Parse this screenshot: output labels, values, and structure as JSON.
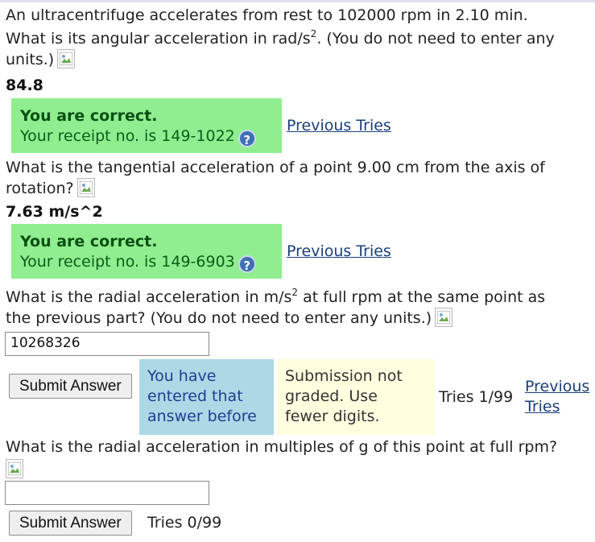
{
  "q1": {
    "line1": "An ultracentrifuge accelerates from rest to 102000 rpm in 2.10 min.",
    "line2_pre": "What is its angular acceleration in rad/s",
    "line2_sup": "2",
    "line2_post": ". (You do not need to enter any",
    "line3": "units.)",
    "answer": "84.8",
    "feedback_title": "You are correct.",
    "receipt": "Your receipt no. is 149-1022",
    "previous_tries": "Previous Tries"
  },
  "q2": {
    "line1": "What is the tangential acceleration of a point 9.00 cm from the axis of",
    "line2": "rotation?",
    "answer": "7.63 m/s^2",
    "feedback_title": "You are correct.",
    "receipt": "Your receipt no. is 149-6903",
    "previous_tries": "Previous Tries"
  },
  "q3": {
    "line1_pre": "What is the radial acceleration in m/s",
    "line1_sup": "2",
    "line1_post": " at full rpm at the same point as",
    "line2": "the previous part? (You do not need to enter any units.)",
    "input_value": "10268326",
    "submit_label": "Submit Answer",
    "notice_blue": [
      "You have",
      "entered that",
      "answer before"
    ],
    "notice_yellow": [
      "Submission not",
      "graded. Use",
      "fewer digits."
    ],
    "tries": "Tries 1/99",
    "previous_tries": [
      "Previous",
      "Tries"
    ]
  },
  "q4": {
    "line1": "What is the radial acceleration in multiples of g of this point at full rpm?",
    "input_value": "",
    "submit_label": "Submit Answer",
    "tries": "Tries 0/99"
  },
  "help_icon_glyph": "?",
  "colors": {
    "correct_bg": "#90ee90",
    "notice_blue_bg": "#add8e6",
    "notice_yellow_bg": "#ffffe0",
    "link": "#1a3f7a"
  }
}
